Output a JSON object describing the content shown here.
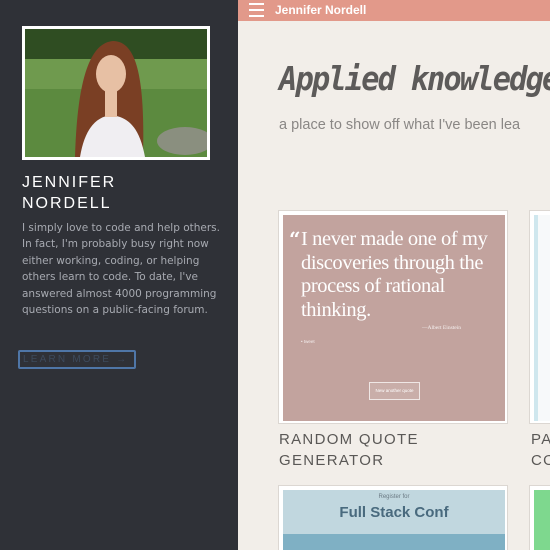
{
  "sidebar": {
    "name_first": "JENNIFER",
    "name_last": "NORDELL",
    "bio": "I simply love to code and help others. In fact, I'm probably busy right now either working, coding, or helping others learn to code. To date, I've answered almost 4000 programming questions on a public-facing forum.",
    "learn_more_label": "LEARN MORE →"
  },
  "topbar": {
    "title": "Jennifer Nordell",
    "menu_icon": "hamburger-menu-icon",
    "color": "#e2998a"
  },
  "main": {
    "heading": "Applied knowledge:",
    "subtitle": "a place to show off what I've been lea",
    "projects": [
      {
        "title": "RANDOM QUOTE GENERATOR",
        "thumb_quote": "I never made one of my discoveries through the process of rational thinking.",
        "thumb_author": "—Albert Einstein",
        "thumb_credit": "• tweet",
        "thumb_button": "New another quote"
      },
      {
        "title_line1": "PA",
        "title_line2": "CO"
      },
      {
        "thumb_kicker": "Register for",
        "thumb_title": "Full Stack Conf"
      }
    ]
  },
  "colors": {
    "sidebar_bg": "#2f3137",
    "page_bg": "#f2eee9",
    "accent": "#e2998a",
    "button_border": "#4f76a7"
  }
}
